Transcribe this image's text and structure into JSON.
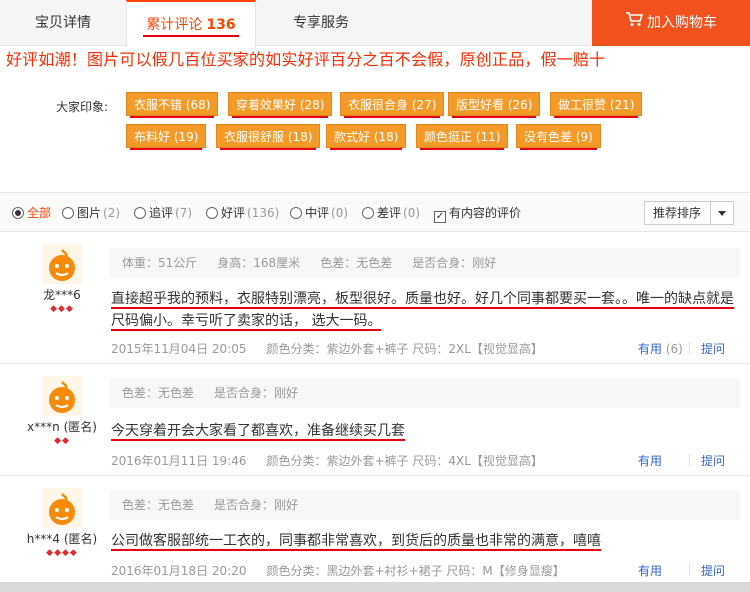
{
  "tabs": {
    "detail": "宝贝详情",
    "reviews_label": "累计评论",
    "reviews_count": "136",
    "service": "专享服务"
  },
  "cart": {
    "label": "加入购物车",
    "icon": "cart-icon"
  },
  "promo": "好评如潮！图片可以假几百位买家的如实好评百分之百不会假，原创正品，假一赔十",
  "impressions": {
    "label": "大家印象:",
    "tags": [
      "衣服不错 (68)",
      "穿着效果好 (28)",
      "衣服很合身 (27)",
      "版型好看 (26)",
      "做工很赞 (21)",
      "布料好 (19)",
      "衣服很舒服 (18)",
      "款式好 (18)",
      "颜色挺正 (11)",
      "没有色差 (9)"
    ]
  },
  "filters": {
    "all": "全部",
    "pics": "图片",
    "pics_count": "(2)",
    "append": "追评",
    "append_count": "(7)",
    "good": "好评",
    "good_count": "(136)",
    "neutral": "中评",
    "neutral_count": "(0)",
    "bad": "差评",
    "bad_count": "(0)",
    "has_content": "有内容的评价",
    "sort": "推荐排序"
  },
  "reviews": [
    {
      "user": "龙***6",
      "meta": [
        "体重：51公斤",
        "身高：168厘米",
        "色差：无色差",
        "是否合身：刚好"
      ],
      "content_line1": "直接超乎我的预料，衣服特别漂亮，板型很好。质量也好。好几个同事都要买一套。。唯一的缺点就是",
      "content_line2": "尺码偏小。幸亏听了卖家的话， 选大一码。",
      "date": "2015年11月04日 20:05",
      "sku": "颜色分类：紫边外套+裤子  尺码：2XL【视觉显高】",
      "useful": "有用",
      "useful_count": "(6)",
      "ask": "提问"
    },
    {
      "user": "x***n (匿名)",
      "meta": [
        "色差：无色差",
        "是否合身：刚好"
      ],
      "content_line1": "今天穿着开会大家看了都喜欢，准备继续买几套",
      "date": "2016年01月11日 19:46",
      "sku": "颜色分类：紫边外套+裤子  尺码：4XL【视觉显高】",
      "useful": "有用",
      "ask": "提问"
    },
    {
      "user": "h***4 (匿名)",
      "meta": [
        "色差：无色差",
        "是否合身：刚好"
      ],
      "content_line1": "公司做客服部统一工衣的，同事都非常喜欢，到货后的质量也非常的满意，嘻嘻",
      "date": "2016年01月18日 20:20",
      "sku": "颜色分类：黑边外套+衬衫+裙子  尺码：M【修身显瘦】",
      "useful": "有用",
      "ask": "提问"
    }
  ]
}
